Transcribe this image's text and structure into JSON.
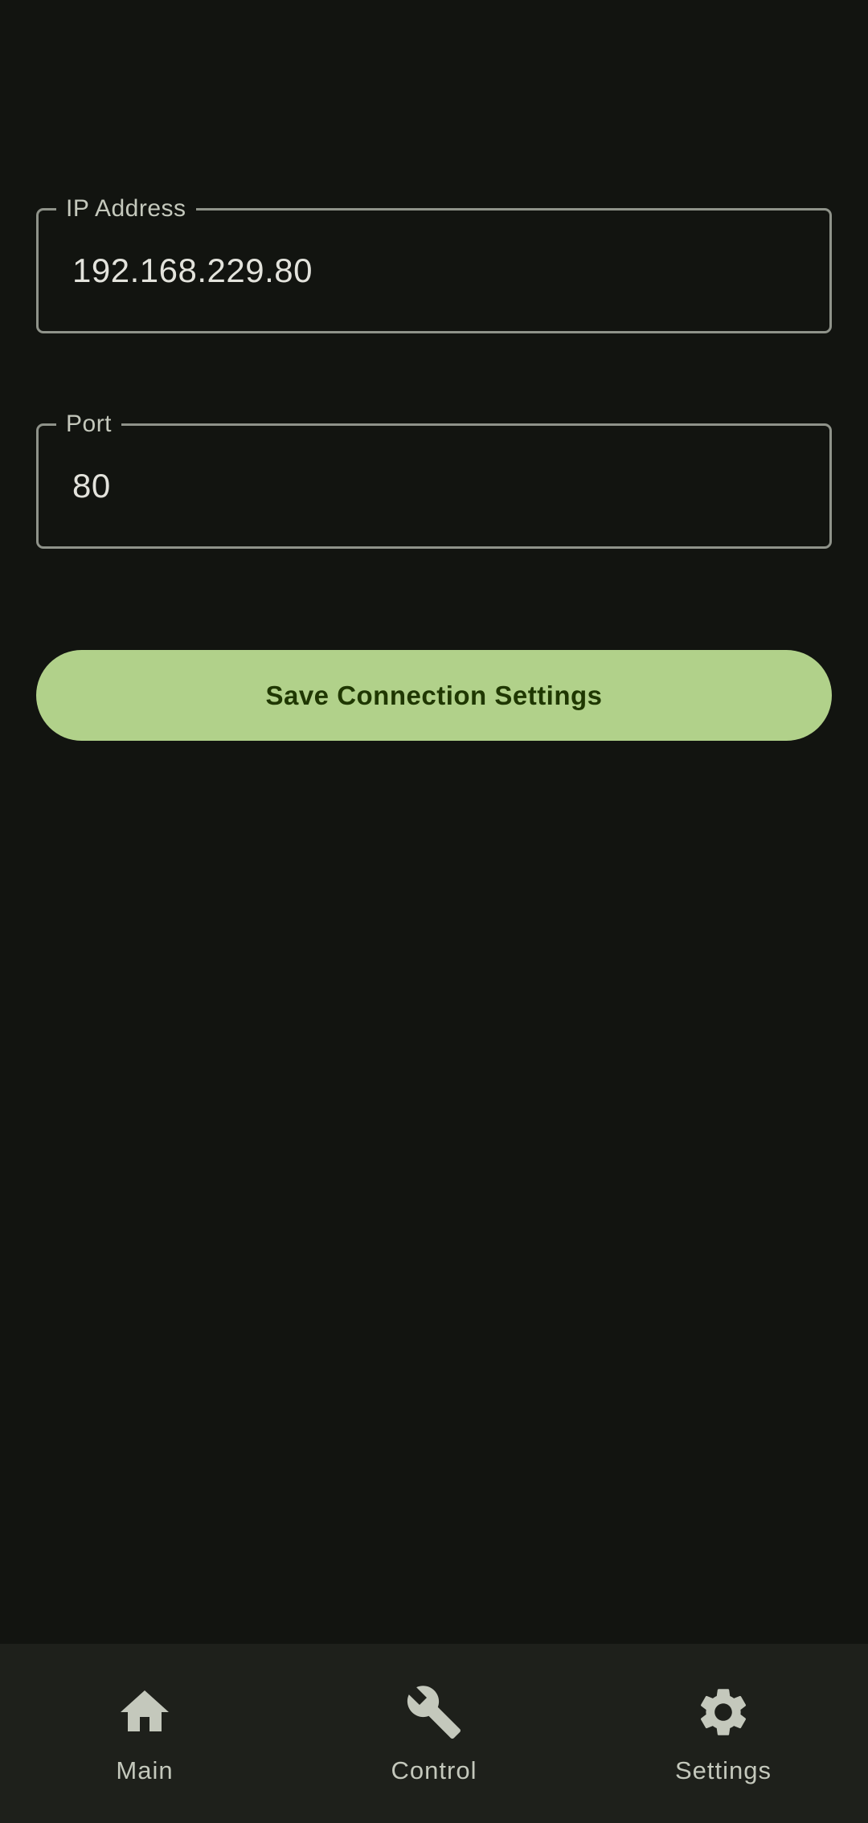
{
  "form": {
    "ip": {
      "label": "IP Address",
      "value": "192.168.229.80"
    },
    "port": {
      "label": "Port",
      "value": "80"
    },
    "save_label": "Save Connection Settings"
  },
  "bottom_nav": {
    "items": [
      {
        "label": "Main",
        "icon": "home-icon"
      },
      {
        "label": "Control",
        "icon": "wrench-icon"
      },
      {
        "label": "Settings",
        "icon": "gear-icon"
      }
    ],
    "selected": "Settings"
  },
  "colors": {
    "background": "#121410",
    "accent": "#b1d18a",
    "on_accent": "#1f3701",
    "outline": "#8f938a",
    "nav_background": "#1e201b"
  }
}
